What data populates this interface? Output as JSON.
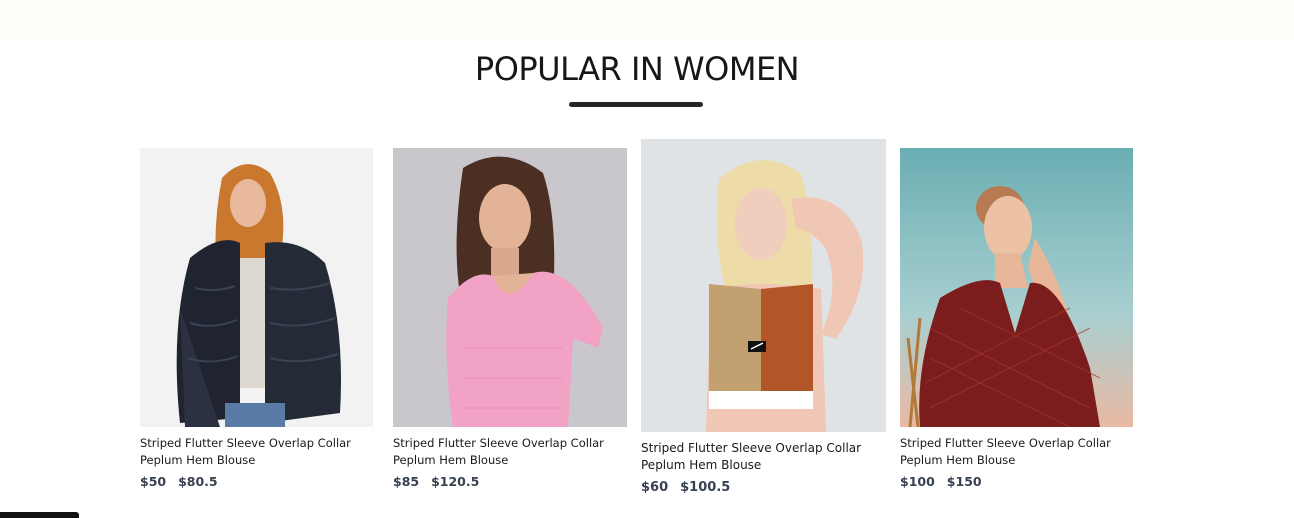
{
  "section": {
    "title": "POPULAR IN WOMEN"
  },
  "products": [
    {
      "name": "Striped Flutter Sleeve Overlap Collar Peplum Hem Blouse",
      "price_new": "$50",
      "price_old": "$80.5",
      "image_icon": "model-fur-jacket-image"
    },
    {
      "name": "Striped Flutter Sleeve Overlap Collar Peplum Hem Blouse",
      "price_new": "$85",
      "price_old": "$120.5",
      "image_icon": "model-pink-top-image"
    },
    {
      "name": "Striped Flutter Sleeve Overlap Collar Peplum Hem Blouse",
      "price_new": "$60",
      "price_old": "$100.5",
      "image_icon": "model-sports-crop-top-image"
    },
    {
      "name": "Striped Flutter Sleeve Overlap Collar Peplum Hem Blouse",
      "price_new": "$100",
      "price_old": "$150",
      "image_icon": "model-red-blouse-image"
    }
  ],
  "colors": {
    "heading": "#171717",
    "price": "#374151",
    "underline": "#252525"
  }
}
